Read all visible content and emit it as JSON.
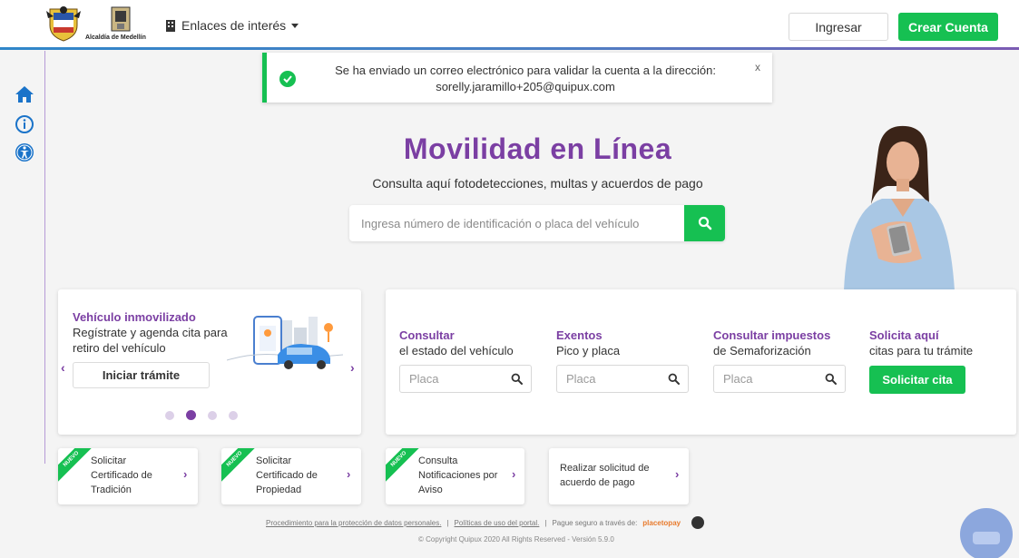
{
  "header": {
    "logo_text": "Alcaldía de Medellín",
    "enlaces_label": "Enlaces de interés",
    "ingresar_label": "Ingresar",
    "crear_cuenta_label": "Crear Cuenta"
  },
  "toast": {
    "message_line1": "Se ha enviado un correo electrónico para validar la cuenta a la dirección:",
    "message_line2": "sorelly.jaramillo+205@quipux.com",
    "close_label": "x"
  },
  "hero": {
    "title": "Movilidad en Línea",
    "subtitle": "Consulta aquí fotodetecciones, multas y acuerdos de pago",
    "search_placeholder": "Ingresa número de identificación o placa del vehículo"
  },
  "carousel": {
    "title": "Vehículo inmovilizado",
    "description": "Regístrate y agenda cita para retiro del vehículo",
    "button_label": "Iniciar trámite",
    "prev": "‹",
    "next": "›",
    "active_dot": 2,
    "dot_count": 4
  },
  "services": [
    {
      "title": "Consultar",
      "subtitle": "el estado del vehículo",
      "placeholder": "Placa"
    },
    {
      "title": "Exentos",
      "subtitle": "Pico y placa",
      "placeholder": "Placa"
    },
    {
      "title": "Consultar impuestos",
      "subtitle": "de Semaforización",
      "placeholder": "Placa"
    },
    {
      "title": "Solicita aquí",
      "subtitle": "citas para tu trámite",
      "button_label": "Solicitar cita"
    }
  ],
  "bottom_cards": [
    {
      "text": "Solicitar Certificado de Tradición",
      "badge": "NUEVO"
    },
    {
      "text": "Solicitar Certificado de Propiedad",
      "badge": "NUEVO"
    },
    {
      "text": "Consulta Notificaciones por Aviso",
      "badge": "NUEVO"
    },
    {
      "text": "Realizar solicitud de acuerdo de pago",
      "badge": ""
    }
  ],
  "footer": {
    "link1": "Procedimiento para la protección de datos personales.",
    "link2": "Políticas de uso del portal.",
    "secure_text": "Pague seguro a través de:",
    "placetopay": "placetopay",
    "separator": "|",
    "copyright": "© Copyright Quipux 2020 All Rights Reserved - Versión 5.9.0"
  },
  "colors": {
    "primary_green": "#16c052",
    "brand_purple": "#7b3fa3",
    "icon_blue": "#1a73c9"
  }
}
